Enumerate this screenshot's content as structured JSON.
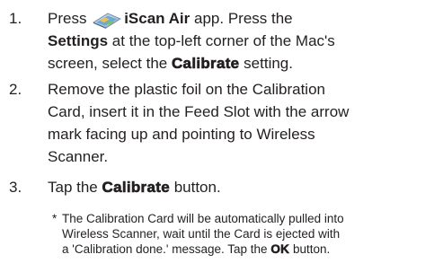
{
  "steps": [
    {
      "number": "1.",
      "lines": {
        "l1_pre": "Press",
        "l1_app": "iScan Air",
        "l1_post": "app.  Press the",
        "l2_settings": "Settings",
        "l2_post": "at the top-left corner of the Mac's",
        "l3_pre": "screen, select the",
        "l3_calibrate": "Calibrate",
        "l3_post": "setting."
      },
      "icon": "iscan-air-app-icon"
    },
    {
      "number": "2.",
      "lines": {
        "l1": "Remove the plastic foil on the Calibration",
        "l2": "Card,  insert it in the Feed Slot with the arrow",
        "l3": "mark facing up and pointing to Wireless",
        "l4": "Scanner."
      }
    },
    {
      "number": "3.",
      "lines": {
        "l1_pre": "Tap the",
        "l1_calibrate": "Calibrate",
        "l1_post": "button."
      }
    }
  ],
  "note": {
    "marker": "*",
    "l1": "The Calibration Card will be automatically pulled into",
    "l2": "Wireless Scanner, wait until the Card is ejected with",
    "l3_pre": "a 'Calibration done.' message. Tap the",
    "l3_ok": "OK",
    "l3_post": "button."
  }
}
